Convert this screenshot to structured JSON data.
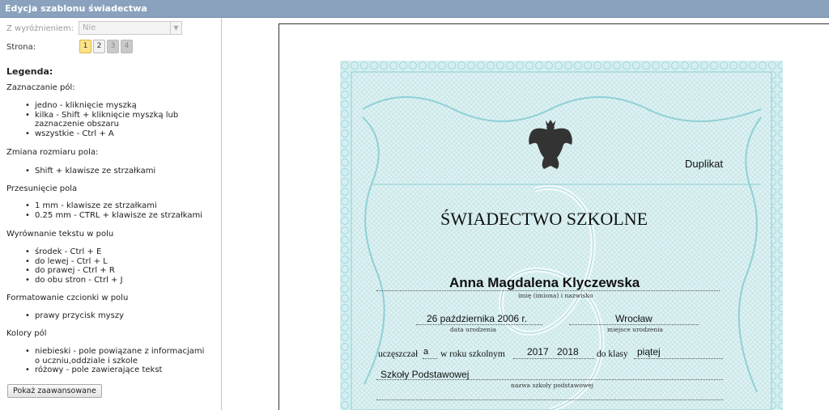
{
  "window": {
    "title": "Edycja szablonu świadectwa"
  },
  "sidebar": {
    "distinction_label": "Z wyróżnieniem:",
    "distinction_value": "Nie",
    "page_label": "Strona:",
    "pages": [
      "1",
      "2",
      "3",
      "4"
    ],
    "legend_title": "Legenda:",
    "sections": [
      {
        "title": "Zaznaczanie pól:",
        "items": [
          "jedno - kliknięcie myszką",
          "kilka - Shift + kliknięcie myszką lub zaznaczenie obszaru",
          "wszystkie - Ctrl + A"
        ]
      },
      {
        "title": "Zmiana rozmiaru pola:",
        "items": [
          "Shift + klawisze ze strzałkami"
        ]
      },
      {
        "title": "Przesunięcie pola",
        "items": [
          "1 mm - klawisze ze strzałkami",
          "0.25 mm - CTRL + klawisze ze strzałkami"
        ]
      },
      {
        "title": "Wyrównanie tekstu w polu",
        "items": [
          "środek - Ctrl + E",
          "do lewej - Ctrl + L",
          "do prawej - Ctrl + R",
          "do obu stron - Ctrl + J"
        ]
      },
      {
        "title": "Formatowanie czcionki w polu",
        "items": [
          "prawy przycisk myszy"
        ]
      },
      {
        "title": "Kolory pól",
        "items": [
          "niebieski - pole powiązane z informacjami o uczniu,oddziale i szkole",
          "różowy - pole zawierające tekst"
        ]
      }
    ],
    "advanced_button": "Pokaż zaawansowane"
  },
  "certificate": {
    "duplicate": "Duplikat",
    "heading": "ŚWIADECTWO SZKOLNE",
    "student_name": "Anna Magdalena Klyczewska",
    "name_caption": "imię (imiona) i nazwisko",
    "birth_date": "26 października 2006 r.",
    "birth_date_caption": "data urodzenia",
    "birth_place": "Wrocław",
    "birth_place_caption": "miejsce urodzenia",
    "attended_label": "uczęszczał",
    "attended_suffix": "a",
    "school_year_label": "w roku szkolnym",
    "year_from": "2017",
    "year_to": "2018",
    "class_label": "do klasy",
    "class_value": "piątej",
    "school_name": "Szkoły Podstawowej",
    "school_caption": "nazwa szkoły podstawowej"
  },
  "colors": {
    "titlebar": "#8aa2bd",
    "guilloche": "#9fd4d8",
    "page_active": "#fbe38a"
  }
}
